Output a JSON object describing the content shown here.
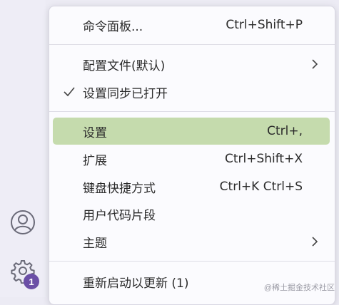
{
  "menu": {
    "items": [
      {
        "label": "命令面板...",
        "keybinding": "Ctrl+Shift+P"
      },
      {
        "label": "配置文件(默认)",
        "submenu": true
      },
      {
        "label": "设置同步已打开",
        "checked": true
      },
      {
        "label": "设置",
        "keybinding": "Ctrl+,",
        "highlighted": true
      },
      {
        "label": "扩展",
        "keybinding": "Ctrl+Shift+X"
      },
      {
        "label": "键盘快捷方式",
        "keybinding": "Ctrl+K Ctrl+S"
      },
      {
        "label": "用户代码片段"
      },
      {
        "label": "主题",
        "submenu": true
      },
      {
        "label": "重新启动以更新 (1)"
      }
    ]
  },
  "activity_bar": {
    "account_icon": "account-icon",
    "manage_icon": "gear-icon",
    "manage_badge": "1"
  },
  "watermark": "@稀土掘金技术社区",
  "colors": {
    "highlight": "#c5dbad",
    "badge": "#6b4fa6"
  }
}
